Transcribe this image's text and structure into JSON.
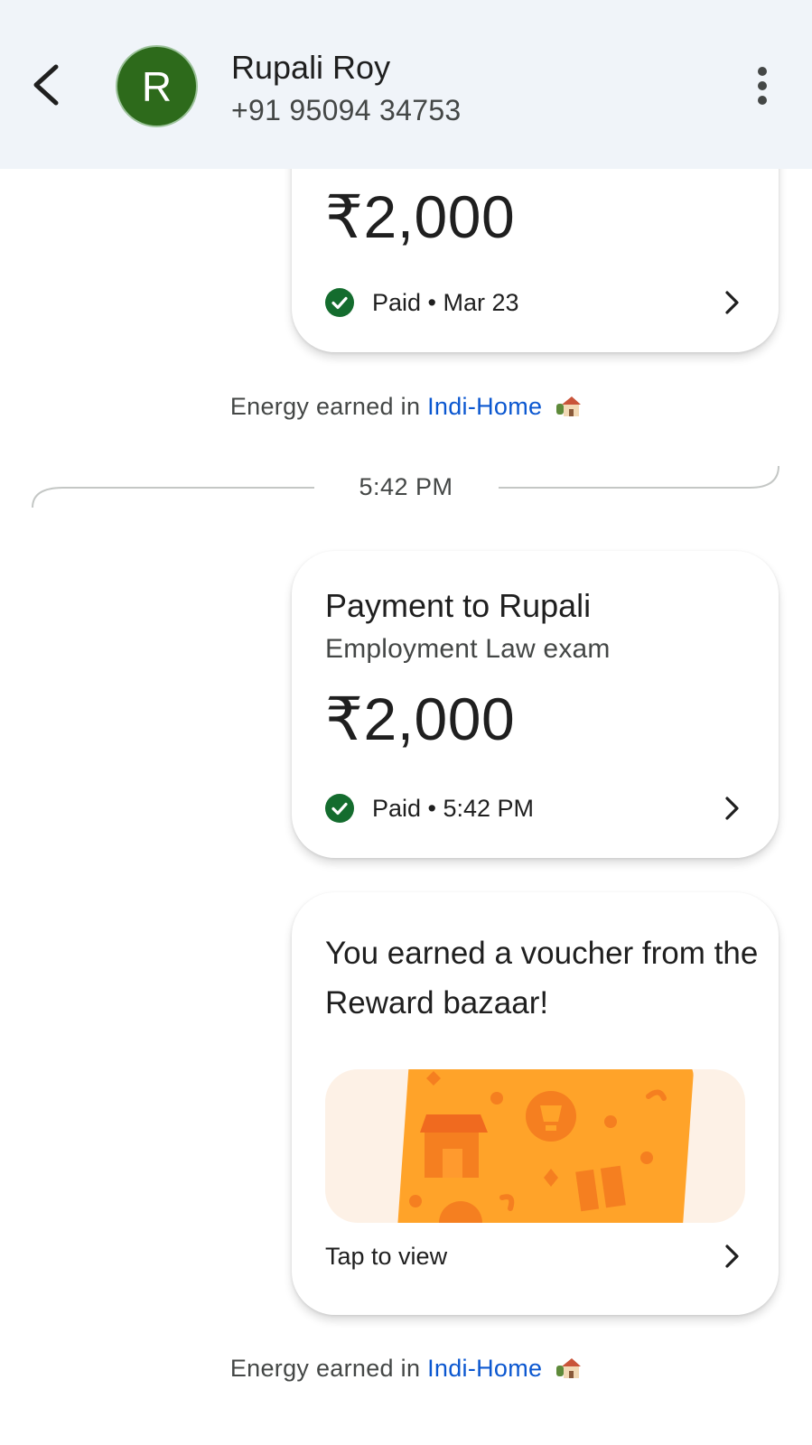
{
  "header": {
    "avatar_initial": "R",
    "contact_name": "Rupali Roy",
    "contact_phone": "+91 95094 34753",
    "avatar_color": "#2d6a1b"
  },
  "messages": {
    "previous_payment": {
      "amount": "₹2,000",
      "status": "Paid • Mar 23"
    },
    "energy_1": {
      "prefix": "Energy earned in",
      "link": "Indi-Home"
    },
    "time_divider": "5:42 PM",
    "payment": {
      "title": "Payment to Rupali",
      "note": "Employment Law exam",
      "amount": "₹2,000",
      "status": "Paid • 5:42 PM"
    },
    "voucher": {
      "title": "You earned a voucher from the Reward bazaar!",
      "action": "Tap to view"
    },
    "energy_2": {
      "prefix": "Energy earned in",
      "link": "Indi-Home"
    }
  },
  "colors": {
    "header_bg": "#f0f4f9",
    "link": "#0b57d0",
    "success_green": "#146c2e",
    "voucher_orange": "#ffa329"
  }
}
